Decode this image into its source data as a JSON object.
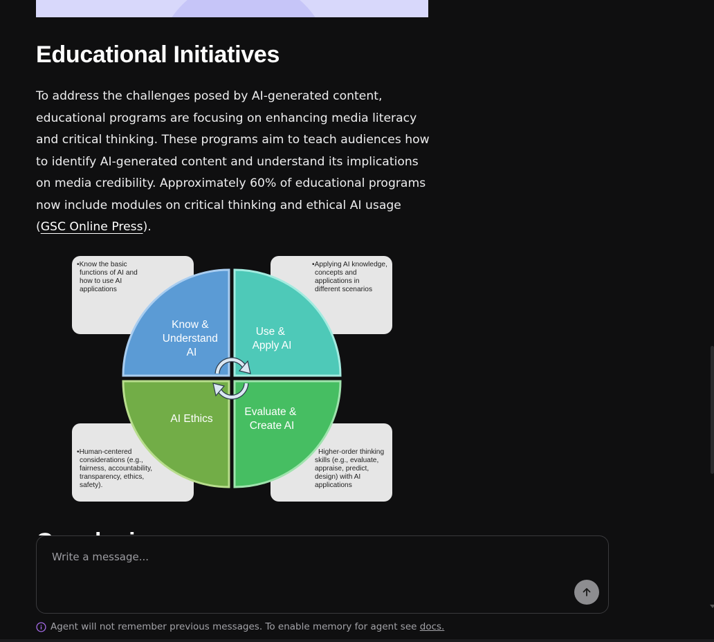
{
  "section": {
    "title": "Educational Initiatives",
    "paragraph_text": "To address the challenges posed by AI-generated content, educational programs are focusing on enhancing media literacy and critical thinking. These programs aim to teach audiences how to identify AI-generated content and understand its implications on media credibility. Approximately 60% of educational programs now include modules on critical thinking and ethical AI usage (",
    "link_text": "GSC Online Press",
    "paragraph_end": ")."
  },
  "diagram": {
    "quadrants": {
      "top_left": [
        "Know &",
        "Understand",
        "AI"
      ],
      "top_right": [
        "Use &",
        "Apply AI"
      ],
      "bottom_left": [
        "AI Ethics"
      ],
      "bottom_right": [
        "Evaluate &",
        "Create AI"
      ]
    },
    "notes": {
      "top_left": [
        "•Know the basic",
        "functions of AI and",
        "how to use AI",
        "applications"
      ],
      "top_right": [
        "•Applying AI knowledge,",
        "concepts and",
        "applications in",
        "different scenarios"
      ],
      "bottom_left": [
        "•Human-centered",
        "considerations (e.g.,",
        "fairness, accountability,",
        "transparency, ethics,",
        "safety)."
      ],
      "bottom_right": [
        "Higher-order thinking",
        "skills (e.g., evaluate,",
        "appraise, predict,",
        "design) with AI",
        "applications"
      ]
    },
    "colors": {
      "blue": "#5b9bd5",
      "teal": "#4ec9b8",
      "olive_green": "#72ad47",
      "green": "#46be62",
      "note_bg": "#e6e6e6"
    }
  },
  "next_heading": "Conclusion",
  "composer": {
    "placeholder": "Write a message...",
    "send_icon": "arrow-up-icon"
  },
  "footer": {
    "info_icon": "info-icon",
    "text": "Agent will not remember previous messages. To enable memory for agent see ",
    "link": "docs."
  }
}
